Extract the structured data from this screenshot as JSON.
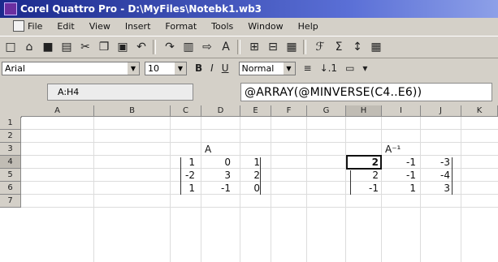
{
  "window": {
    "title": "Corel Quattro Pro - D:\\MyFiles\\Notebk1.wb3"
  },
  "menubar": {
    "items": [
      "File",
      "Edit",
      "View",
      "Insert",
      "Format",
      "Tools",
      "Window",
      "Help"
    ]
  },
  "toolbar": {
    "icons": [
      "new-icon",
      "open-icon",
      "save-icon",
      "print-icon",
      "cut-icon",
      "copy-icon",
      "paste-icon",
      "undo-icon",
      "redo-icon",
      "bold-icon",
      "chart-icon",
      "text-icon",
      "insert-icon",
      "delete-icon",
      "fit-icon",
      "function-icon",
      "sum-icon",
      "table-icon"
    ]
  },
  "propbar": {
    "font": "Arial",
    "size": "10",
    "style": "Normal",
    "bold": "B",
    "italic": "I",
    "underline": "U"
  },
  "inputline": {
    "cellref": "A:H4",
    "formula": "@ARRAY(@MINVERSE(C4..E6))"
  },
  "grid": {
    "columns": [
      "A",
      "B",
      "C",
      "D",
      "E",
      "F",
      "G",
      "H",
      "I",
      "J",
      "K"
    ],
    "rows": [
      "1",
      "2",
      "3",
      "4",
      "5",
      "6",
      "7"
    ],
    "active_column": "H",
    "active_row": "4",
    "label_left": "A",
    "label_right": "A⁻¹",
    "matrix_a": [
      [
        "1",
        "0",
        "1"
      ],
      [
        "-2",
        "3",
        "2"
      ],
      [
        "1",
        "-1",
        "0"
      ]
    ],
    "matrix_inv": [
      [
        "2",
        "-1",
        "-3"
      ],
      [
        "2",
        "-1",
        "-4"
      ],
      [
        "-1",
        "1",
        "3"
      ]
    ]
  }
}
